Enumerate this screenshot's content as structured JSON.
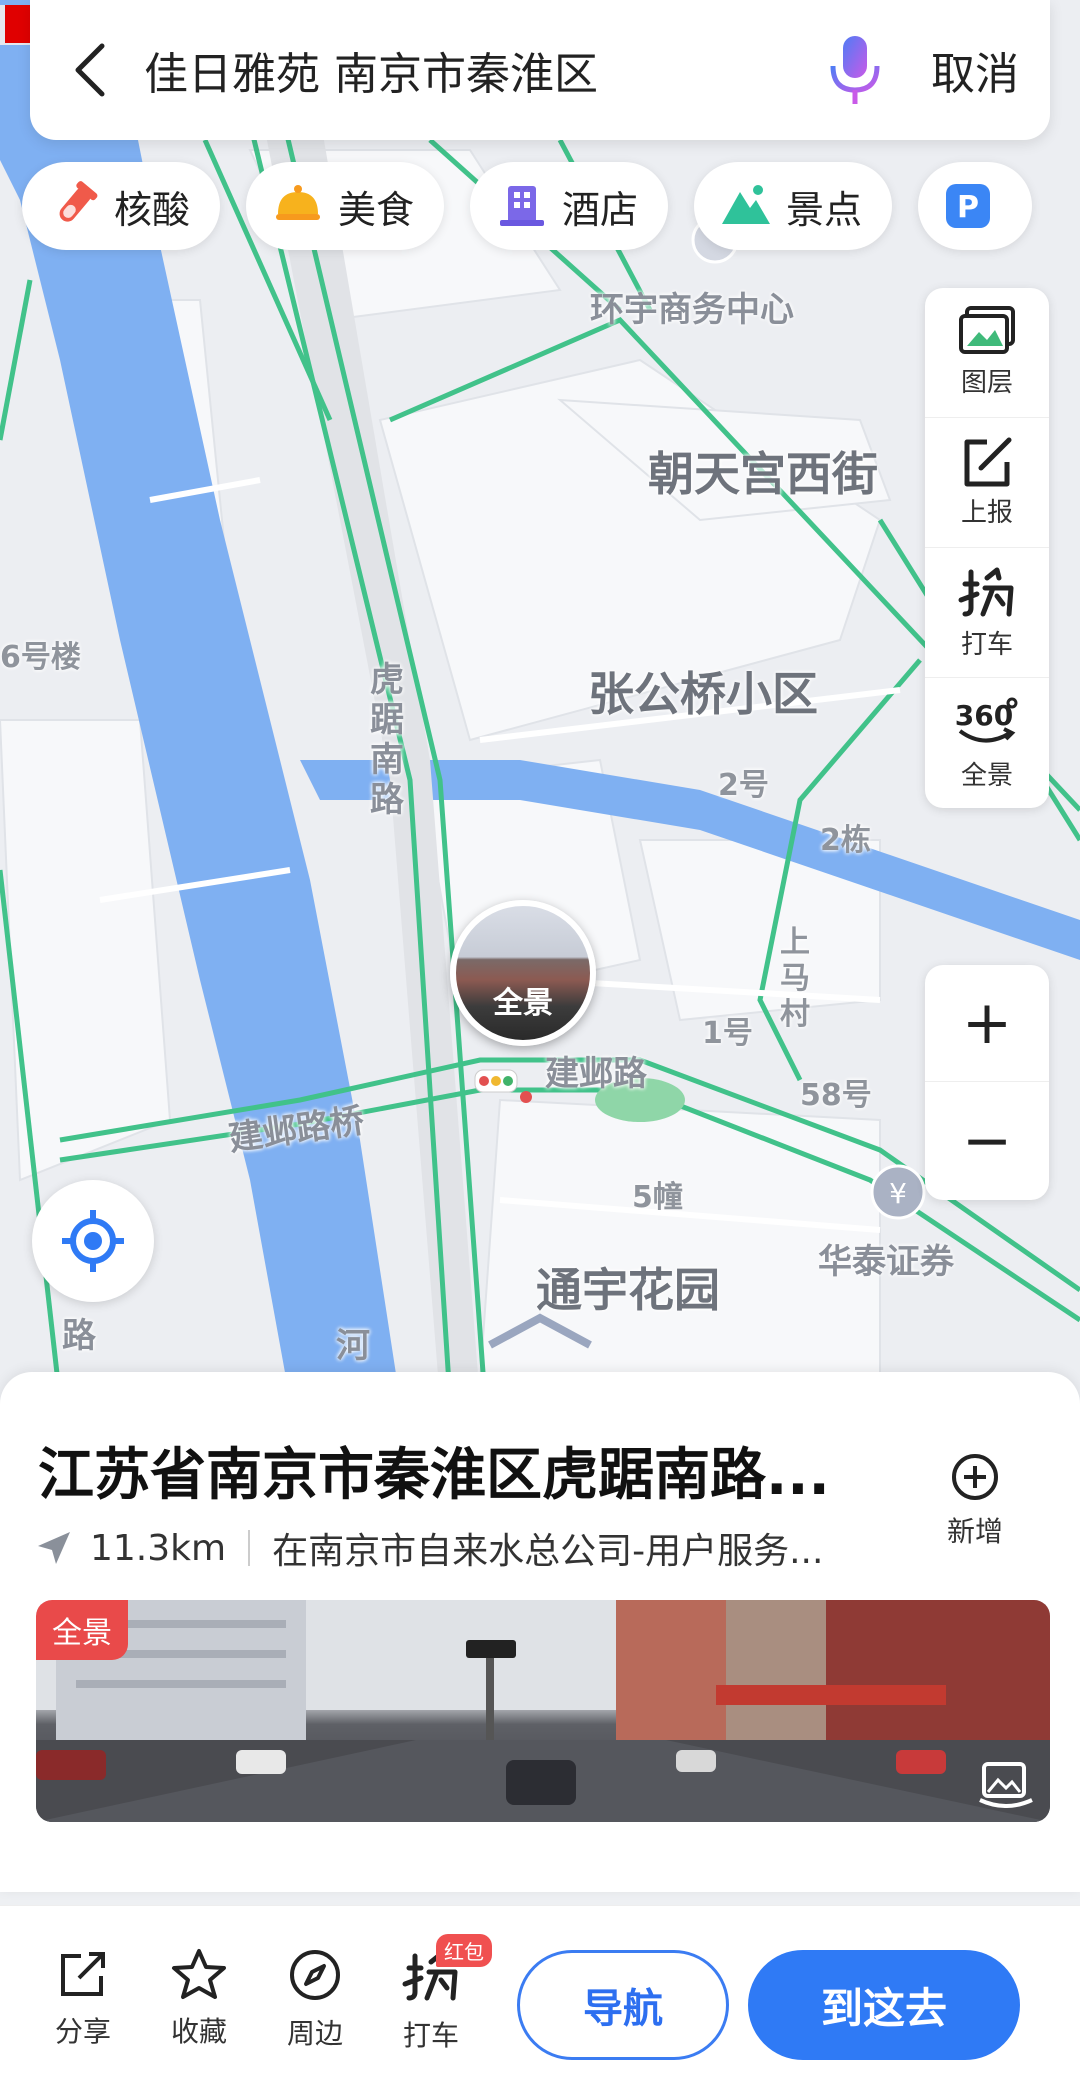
{
  "search": {
    "query": "佳日雅苑 南京市秦淮区",
    "cancel_label": "取消"
  },
  "chips": [
    {
      "label": "核酸",
      "icon": "test-tube-icon"
    },
    {
      "label": "美食",
      "icon": "food-icon"
    },
    {
      "label": "酒店",
      "icon": "hotel-icon"
    },
    {
      "label": "景点",
      "icon": "mountain-icon"
    },
    {
      "label": "",
      "icon": "parking-icon"
    }
  ],
  "tools": [
    {
      "label": "图层",
      "icon": "layers-icon"
    },
    {
      "label": "上报",
      "icon": "report-icon"
    },
    {
      "label": "打车",
      "icon": "taxi-icon"
    },
    {
      "label": "全景",
      "icon": "panorama-360-icon"
    }
  ],
  "zoom": {
    "in": "+",
    "out": "−"
  },
  "map": {
    "labels": {
      "huanyu": "环宇商务中心",
      "chaotian": "朝天宫西街",
      "zhanggong": "张公桥小区",
      "no6": "6号楼",
      "hujunan": "虎踞南路",
      "no2": "2号",
      "dong2": "2栋",
      "shangma": "上马村",
      "no1": "1号",
      "jianye": "建邺路",
      "no58": "58号",
      "jianyebridge": "建邺路桥",
      "zhuang5": "5幢",
      "huatai": "华泰证券",
      "tongyu": "通宇花园",
      "he": "河",
      "lu": "路"
    },
    "pano_bubble_label": "全景"
  },
  "place": {
    "title": "江苏省南京市秦淮区虎踞南路...",
    "distance": "11.3km",
    "address": "在南京市自来水总公司-用户服务...",
    "add_label": "新增",
    "photo_badge": "全景"
  },
  "actions": {
    "share": "分享",
    "favorite": "收藏",
    "nearby": "周边",
    "taxi": "打车",
    "taxi_badge": "红包",
    "navigate": "导航",
    "go": "到这去"
  },
  "colors": {
    "accent": "#2f7af5",
    "road_green": "#41c28a",
    "water": "#7fb0f2",
    "badge_red": "#e94a4a"
  }
}
